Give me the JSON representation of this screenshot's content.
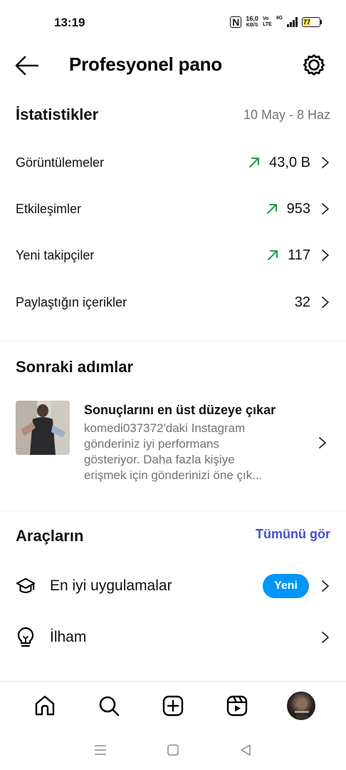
{
  "status_bar": {
    "time": "13:19",
    "nfc": "N",
    "speed_value": "16,0",
    "speed_unit": "KB/S",
    "volte_top": "Vo",
    "volte_bottom": "LTE",
    "network": "4G",
    "battery": "77"
  },
  "header": {
    "title": "Profesyonel pano"
  },
  "stats": {
    "title": "İstatistikler",
    "date_range": "10 May - 8 Haz",
    "rows": [
      {
        "label": "Görüntülemeler",
        "value": "43,0 B",
        "trend": "up"
      },
      {
        "label": "Etkileşimler",
        "value": "953",
        "trend": "up"
      },
      {
        "label": "Yeni takipçiler",
        "value": "117",
        "trend": "up"
      },
      {
        "label": "Paylaştığın içerikler",
        "value": "32",
        "trend": ""
      }
    ]
  },
  "next_steps": {
    "title": "Sonraki adımlar",
    "card": {
      "title": "Sonuçlarını en üst düzeye çıkar",
      "line1": "komedi037372'daki Instagram",
      "line2": "gönderiniz iyi performans",
      "line3": "gösteriyor. Daha fazla kişiye",
      "line4": "erişmek için gönderinizi öne çık..."
    }
  },
  "tools": {
    "title": "Araçların",
    "see_all": "Tümünü gör",
    "items": [
      {
        "label": "En iyi uygulamalar",
        "badge": "Yeni",
        "icon": "graduation-cap-icon"
      },
      {
        "label": "İlham",
        "badge": "",
        "icon": "lightbulb-icon"
      }
    ]
  },
  "colors": {
    "trend_green": "#1a9e3f",
    "link_blue": "#3f51d6",
    "badge_blue": "#0095f6",
    "secondary_text": "#737373"
  }
}
